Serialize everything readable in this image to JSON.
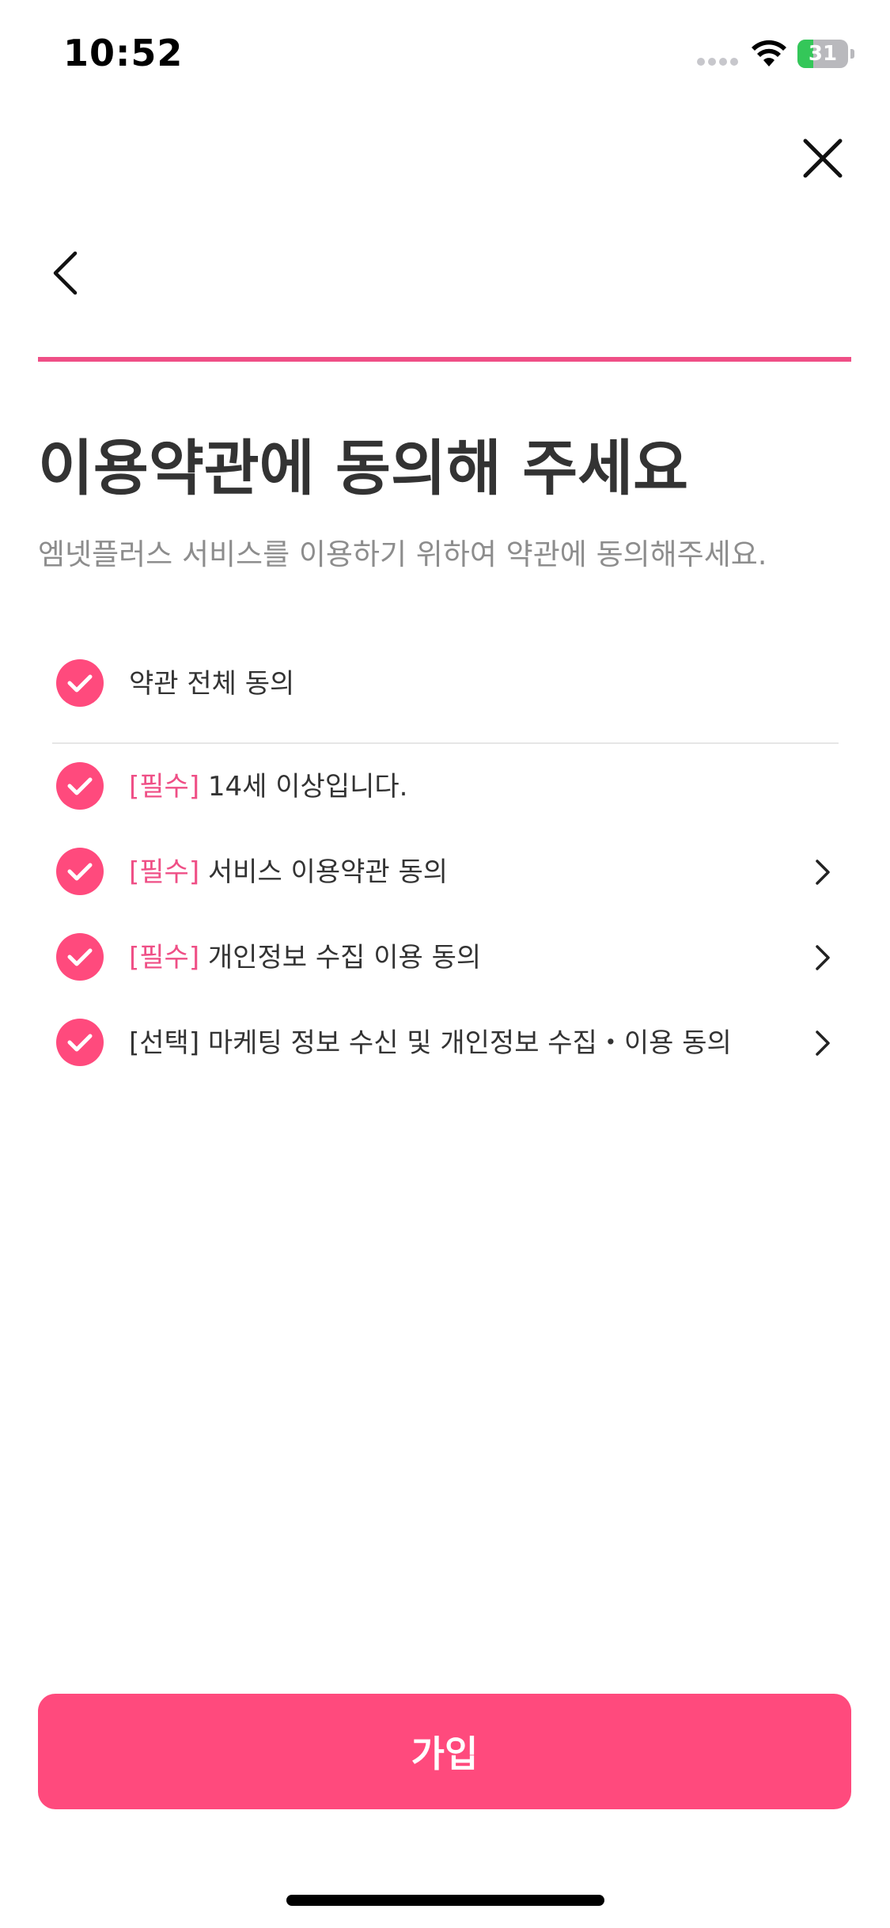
{
  "status_bar": {
    "time": "10:52",
    "battery_percent": 31,
    "battery_label": "31",
    "battery_color": "#34c759"
  },
  "nav": {
    "close_icon": "close-icon",
    "back_icon": "chevron-left-icon"
  },
  "progress": {
    "fraction": 1.0,
    "color": "#ef4f86"
  },
  "title": "이용약관에 동의해 주세요",
  "subtitle": "엠넷플러스 서비스를 이용하기 위하여 약관에 동의해주세요.",
  "agreements": {
    "all": {
      "label": "약관 전체 동의",
      "checked": true
    },
    "items": [
      {
        "tag": "[필수]",
        "label": "14세 이상입니다.",
        "checked": true,
        "has_detail": false
      },
      {
        "tag": "[필수]",
        "label": "서비스 이용약관 동의",
        "checked": true,
        "has_detail": true
      },
      {
        "tag": "[필수]",
        "label": "개인정보 수집 이용 동의",
        "checked": true,
        "has_detail": true
      },
      {
        "tag": "[선택]",
        "label": "마케팅 정보 수신 및 개인정보 수집・이용 동의",
        "checked": true,
        "has_detail": true
      }
    ]
  },
  "join_button": {
    "label": "가입",
    "color": "#ff4a7d"
  },
  "colors": {
    "accent": "#ff4a7d",
    "tag_required": "#ef4f86",
    "subtitle": "#8d8d8d",
    "title": "#333333"
  }
}
